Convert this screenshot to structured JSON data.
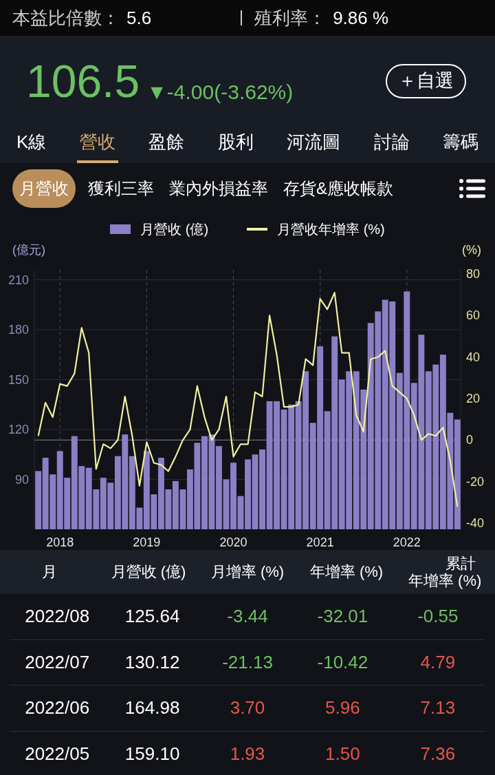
{
  "stats_bar": [
    {
      "label": "本益比倍數：",
      "value": "5.6"
    },
    {
      "label": "殖利率：",
      "value": "9.86 %"
    }
  ],
  "quote": {
    "price": "106.5",
    "change": "▼-4.00(-3.62%)",
    "color": "#6cc062",
    "watchlist_button": "＋自選"
  },
  "tabs": [
    {
      "label": "K線",
      "selected": false
    },
    {
      "label": "營收",
      "selected": true
    },
    {
      "label": "盈餘",
      "selected": false
    },
    {
      "label": "股利",
      "selected": false
    },
    {
      "label": "河流圖",
      "selected": false
    },
    {
      "label": "討論",
      "selected": false
    },
    {
      "label": "籌碼",
      "selected": false
    }
  ],
  "sub_tabs": [
    {
      "label": "月營收",
      "selected": true
    },
    {
      "label": "獲利三率",
      "selected": false
    },
    {
      "label": "業內外損益率",
      "selected": false
    },
    {
      "label": "存貨&應收帳款",
      "selected": false
    }
  ],
  "chart": {
    "chart_data": {
      "type": "bar",
      "grid": true,
      "legend": "top",
      "ylabel": "(億元)",
      "y2label": "(%)",
      "xlim": [
        2017.705,
        2022.62
      ],
      "ylim": [
        60,
        216
      ],
      "y2lim": [
        -43,
        82
      ],
      "yticks": [
        90,
        120,
        150,
        180,
        210
      ],
      "y2ticks": [
        -40,
        -20,
        0,
        20,
        40,
        60,
        80
      ],
      "xticks": [
        2018,
        2019,
        2020,
        2021,
        2022
      ],
      "x": [
        2017.75,
        2017.833,
        2017.917,
        2018,
        2018.083,
        2018.167,
        2018.25,
        2018.333,
        2018.417,
        2018.5,
        2018.583,
        2018.667,
        2018.75,
        2018.833,
        2018.917,
        2019,
        2019.083,
        2019.167,
        2019.25,
        2019.333,
        2019.417,
        2019.5,
        2019.583,
        2019.667,
        2019.75,
        2019.833,
        2019.917,
        2020,
        2020.083,
        2020.167,
        2020.25,
        2020.333,
        2020.417,
        2020.5,
        2020.583,
        2020.667,
        2020.75,
        2020.833,
        2020.917,
        2021,
        2021.083,
        2021.167,
        2021.25,
        2021.333,
        2021.417,
        2021.5,
        2021.583,
        2021.667,
        2021.75,
        2021.833,
        2021.917,
        2022,
        2022.083,
        2022.167,
        2022.25,
        2022.333,
        2022.417,
        2022.5,
        2022.583
      ],
      "series": [
        {
          "name": "月營收 (億)",
          "color": "#8b80c6",
          "values": [
            95,
            103,
            93,
            107,
            91,
            116,
            98,
            97,
            84,
            91,
            88,
            104,
            117,
            104,
            73,
            107,
            81,
            103,
            84,
            89,
            84,
            96,
            112,
            116,
            117,
            110,
            90,
            100,
            80,
            102,
            105,
            108,
            137,
            137,
            132,
            135,
            137,
            155,
            124,
            170,
            131,
            176,
            150,
            155,
            155,
            144,
            184,
            191,
            198,
            197,
            154,
            203,
            148,
            177,
            155,
            159,
            165,
            130,
            126
          ]
        },
        {
          "name": "月營收年增率 (%)",
          "type": "line",
          "axis": "y2",
          "color": "#f3eea0",
          "values": [
            2,
            18,
            11,
            27,
            26,
            32,
            54,
            42,
            -14,
            -2,
            -4,
            0,
            21,
            2,
            -22,
            -1,
            -11,
            -12,
            -15,
            -8,
            0,
            5,
            26,
            11,
            0,
            5,
            21,
            -8,
            -2,
            -2,
            23,
            21,
            60,
            41,
            16,
            16,
            17,
            39,
            36,
            68,
            63,
            71,
            42,
            42,
            12,
            4,
            39,
            40,
            43,
            26,
            23,
            20,
            12,
            0,
            3,
            2,
            6,
            -10,
            -32
          ]
        }
      ]
    }
  },
  "table": {
    "columns": [
      "月",
      "月營收 (億)",
      "月增率 (%)",
      "年增率 (%)",
      "累計年增率 (%)"
    ],
    "rows": [
      {
        "cells": [
          {
            "text": "2022/08"
          },
          {
            "text": "125.64"
          },
          {
            "text": "-3.44",
            "color": "#6cc062"
          },
          {
            "text": "-32.01",
            "color": "#6cc062"
          },
          {
            "text": "-0.55",
            "color": "#6cc062"
          }
        ]
      },
      {
        "cells": [
          {
            "text": "2022/07"
          },
          {
            "text": "130.12"
          },
          {
            "text": "-21.13",
            "color": "#6cc062"
          },
          {
            "text": "-10.42",
            "color": "#6cc062"
          },
          {
            "text": "4.79",
            "color": "#e6564c"
          }
        ]
      },
      {
        "cells": [
          {
            "text": "2022/06"
          },
          {
            "text": "164.98"
          },
          {
            "text": "3.70",
            "color": "#e6564c"
          },
          {
            "text": "5.96",
            "color": "#e6564c"
          },
          {
            "text": "7.13",
            "color": "#e6564c"
          }
        ]
      },
      {
        "cells": [
          {
            "text": "2022/05"
          },
          {
            "text": "159.10"
          },
          {
            "text": "1.93",
            "color": "#e6564c"
          },
          {
            "text": "1.50",
            "color": "#e6564c"
          },
          {
            "text": "7.36",
            "color": "#e6564c"
          }
        ]
      }
    ]
  }
}
